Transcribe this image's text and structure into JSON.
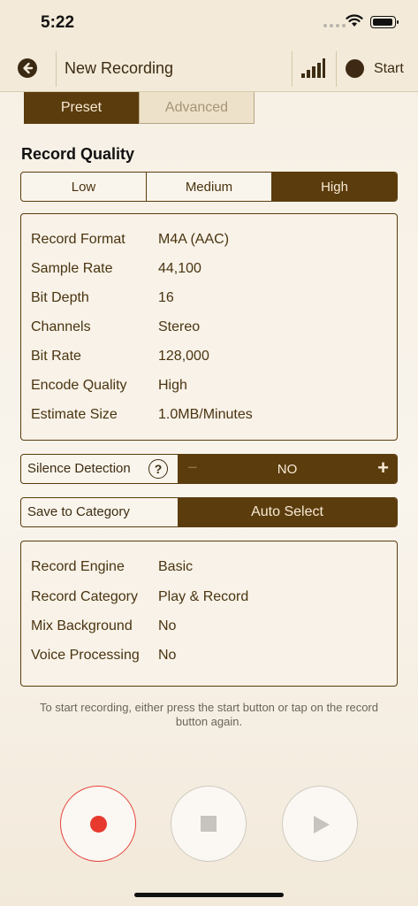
{
  "status_bar": {
    "time": "5:22"
  },
  "nav": {
    "title": "New Recording",
    "start_label": "Start"
  },
  "tabs": [
    {
      "label": "Preset",
      "active": true
    },
    {
      "label": "Advanced",
      "active": false
    }
  ],
  "quality": {
    "section_title": "Record Quality",
    "options": [
      "Low",
      "Medium",
      "High"
    ],
    "selected": "High"
  },
  "format_info": [
    {
      "label": "Record Format",
      "value": "M4A (AAC)"
    },
    {
      "label": "Sample Rate",
      "value": "44,100"
    },
    {
      "label": "Bit Depth",
      "value": "16"
    },
    {
      "label": "Channels",
      "value": "Stereo"
    },
    {
      "label": "Bit Rate",
      "value": "128,000"
    },
    {
      "label": "Encode Quality",
      "value": "High"
    },
    {
      "label": "Estimate Size",
      "value": "1.0MB/Minutes"
    }
  ],
  "silence_detection": {
    "label": "Silence Detection",
    "help": "?",
    "value": "NO",
    "minus": "−",
    "plus": "+"
  },
  "save_category": {
    "label": "Save to Category",
    "value": "Auto Select"
  },
  "engine_info": [
    {
      "label": "Record Engine",
      "value": "Basic"
    },
    {
      "label": "Record Category",
      "value": "Play & Record"
    },
    {
      "label": "Mix Background",
      "value": "No"
    },
    {
      "label": "Voice Processing",
      "value": "No"
    }
  ],
  "hint": "To start recording, either press the start button or tap on the record button again.",
  "colors": {
    "accent": "#5b3c0d",
    "record": "#e8392f",
    "background": "#f6efe3"
  }
}
